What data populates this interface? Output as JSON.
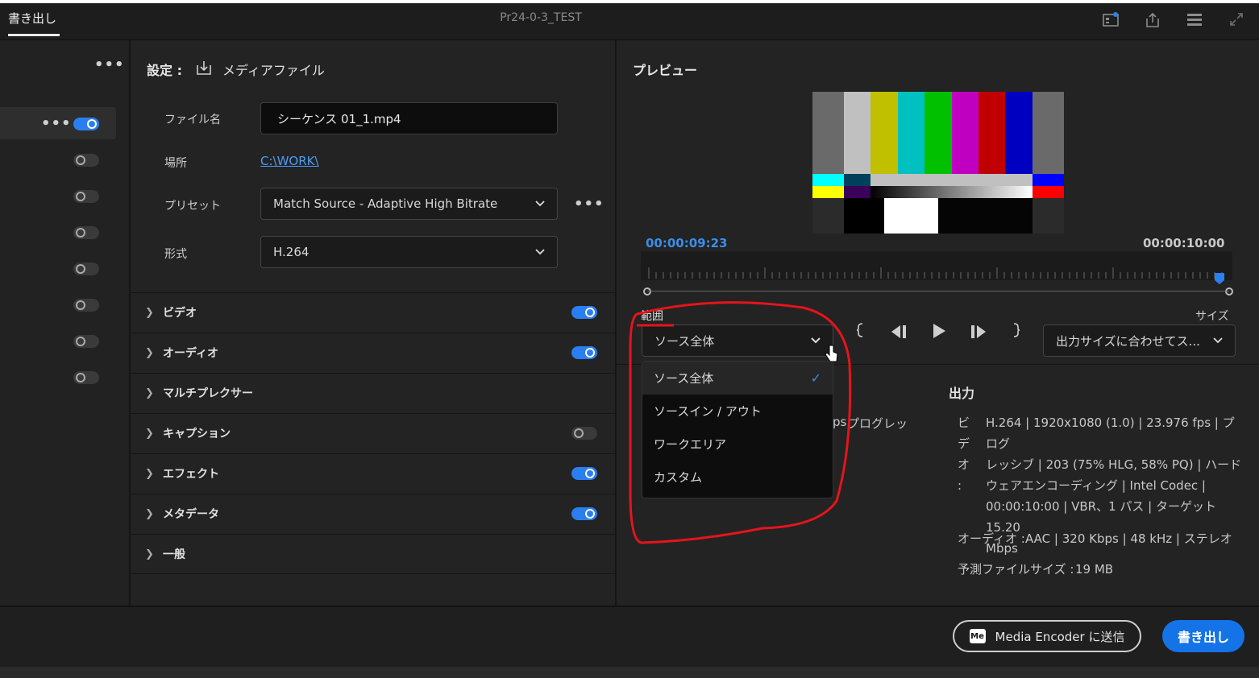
{
  "header": {
    "tab_label": "書き出し",
    "window_title": "Pr24-0-3_TEST",
    "icons": [
      "media-browser-icon",
      "share-icon",
      "queue-icon",
      "expand-icon"
    ]
  },
  "destinations": {
    "more_label": "•••",
    "row_more_label": "•••",
    "toggles": [
      true,
      false,
      false,
      false,
      false,
      false,
      false,
      false
    ]
  },
  "settings": {
    "heading": "設定 :",
    "type_label": "メディアファイル",
    "file_name_label": "ファイル名",
    "file_name_value": "シーケンス 01_1.mp4",
    "location_label": "場所",
    "location_value": "C:\\WORK\\",
    "preset_label": "プリセット",
    "preset_value": "Match Source - Adaptive High Bitrate",
    "preset_more": "•••",
    "format_label": "形式",
    "format_value": "H.264",
    "sections": [
      {
        "title": "ビデオ",
        "toggle": "on"
      },
      {
        "title": "オーディオ",
        "toggle": "on"
      },
      {
        "title": "マルチプレクサー",
        "toggle": "none"
      },
      {
        "title": "キャプション",
        "toggle": "off"
      },
      {
        "title": "エフェクト",
        "toggle": "on"
      },
      {
        "title": "メタデータ",
        "toggle": "on"
      },
      {
        "title": "一般",
        "toggle": "none"
      }
    ]
  },
  "preview": {
    "heading": "プレビュー",
    "current_time": "00:00:09:23",
    "duration": "00:00:10:00",
    "range_label": "範囲",
    "range_value": "ソース全体",
    "size_label": "サイズ",
    "size_value": "出力サイズに合わせてス...",
    "range_options": [
      {
        "label": "ソース全体",
        "selected": true
      },
      {
        "label": "ソースイン / アウト",
        "selected": false
      },
      {
        "label": "ワークエリア",
        "selected": false
      },
      {
        "label": "カスタム",
        "selected": false
      }
    ],
    "partial_text": "ps",
    "partial_text2": "プログレッ"
  },
  "output": {
    "heading": "出力",
    "video_label": "ビデオ :",
    "video_lines": [
      "H.264 | 1920x1080 (1.0) | 23.976 fps | プログ",
      "レッシブ | 203 (75% HLG, 58% PQ) | ハード",
      "ウェアエンコーディング | Intel Codec |",
      "00:00:10:00  | VBR、1 パス | ターゲット 15.20",
      "Mbps"
    ],
    "audio_label": "オーディオ :",
    "audio_value": "AAC | 320 Kbps | 48 kHz | ステレオ",
    "filesize_label": "予測ファイルサイズ :",
    "filesize_value": "19 MB"
  },
  "footer": {
    "me_badge": "Me",
    "send_label": "Media Encoder に送信",
    "export_label": "書き出し"
  },
  "colors": {
    "accent": "#1473e6",
    "toggle_on": "#2a7ff0",
    "annotation": "#e5141c"
  }
}
